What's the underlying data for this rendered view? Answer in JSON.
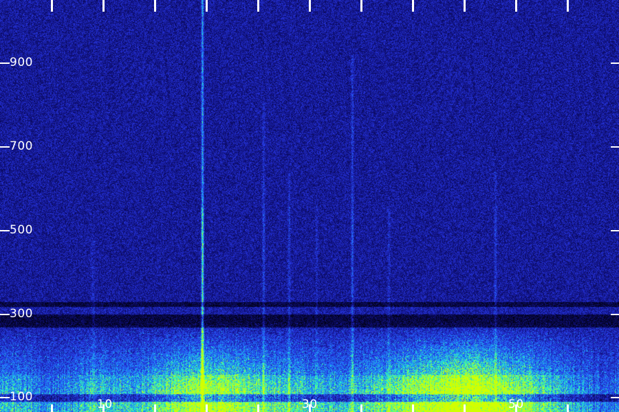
{
  "y_axis": {
    "tick_labels": [
      "900",
      "700",
      "500",
      "300",
      "100"
    ],
    "tick_values": [
      900,
      700,
      500,
      300,
      100
    ],
    "range": [
      80,
      1040
    ]
  },
  "x_axis": {
    "tick_labels": [
      "10",
      "30",
      "50"
    ],
    "tick_values": [
      10,
      30,
      50
    ],
    "tick_count": 12,
    "range": [
      0,
      60
    ]
  },
  "colors": {
    "background": "#1a1a7a",
    "tick": "#ffffff",
    "colormap": [
      "#000010",
      "#10107e",
      "#2838e6",
      "#1e8cff",
      "#28ffbe",
      "#d2ff00"
    ]
  }
}
